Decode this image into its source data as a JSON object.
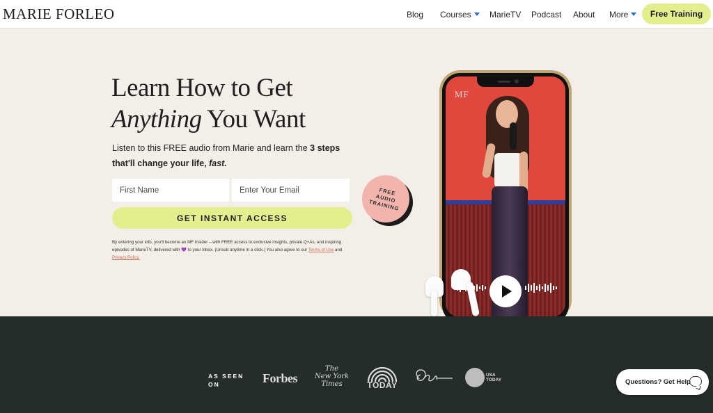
{
  "header": {
    "logo": "MARIE FORLEO",
    "nav": [
      "Blog",
      "Courses",
      "MarieTV",
      "Podcast",
      "About",
      "More"
    ],
    "cta": "Free Training"
  },
  "hero": {
    "headline_line1": "Learn How to Get",
    "headline_italic": "Anything",
    "headline_rest": " You Want",
    "sub_plain": "Listen to this FREE audio from Marie and learn the ",
    "sub_bold": "3 steps that'll change your life, ",
    "sub_italic": "fast.",
    "first_name_placeholder": "First Name",
    "email_placeholder": "Enter Your Email",
    "cta": "GET INSTANT ACCESS",
    "legal_a": "By entering your info, you'll become an MF Insider – with FREE access to exclusive insights, private Q+As, and inspiring episodes of MarieTV, delivered with ",
    "legal_heart": "💜",
    "legal_b": " to your inbox. (Unsub anytime in a click.) You also agree to our ",
    "terms": "Terms of Use",
    "legal_and": " and ",
    "privacy": "Privacy Policy.",
    "badge_line1": "FREE",
    "badge_line2": "AUDIO",
    "badge_line3": "TRAINING",
    "phone_mark": "MF"
  },
  "footer": {
    "seen_line1": "AS SEEN",
    "seen_line2": "ON",
    "forbes": "Forbes",
    "nyt_line1": "The",
    "nyt_line2": "New York",
    "nyt_line3": "Times",
    "today": "TODAY",
    "usa_line1": "USA",
    "usa_line2": "TODAY"
  },
  "chat": {
    "label": "Questions? Get Help"
  },
  "colors": {
    "accent": "#e5ee8e",
    "hero_bg": "#f3eee8",
    "footer_bg": "#242d28",
    "badge": "#f2b5ad",
    "phone_screen": "#e0473d"
  }
}
